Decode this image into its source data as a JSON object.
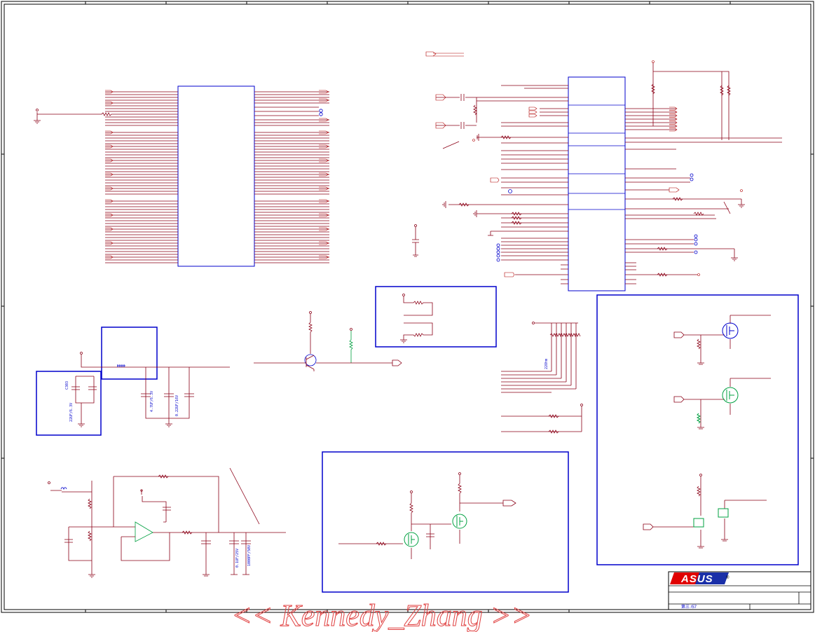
{
  "component_labels": {
    "cap_c303": "C303",
    "cap_22uf": "22UF/6.3V",
    "cap_47uf": "4.7UF/6.3V",
    "cap_022uf": "0.22UF/16V",
    "cap_01uf": "0.1UF/25V",
    "cap_1000pf": "1000PF/50V",
    "res_22ohm": "22Ohm"
  },
  "title_block": {
    "logo_text": "ASUS",
    "registered_mark": "®",
    "page_label": "第三 /57"
  },
  "watermark": "<< Kennedy_Zhang >>",
  "colors": {
    "wire": "#8b0016",
    "component": "#0000cc",
    "highlight": "#00a040",
    "logo_red": "#e00000",
    "logo_blue": "#1a2fa8",
    "watermark": "#e04040"
  }
}
